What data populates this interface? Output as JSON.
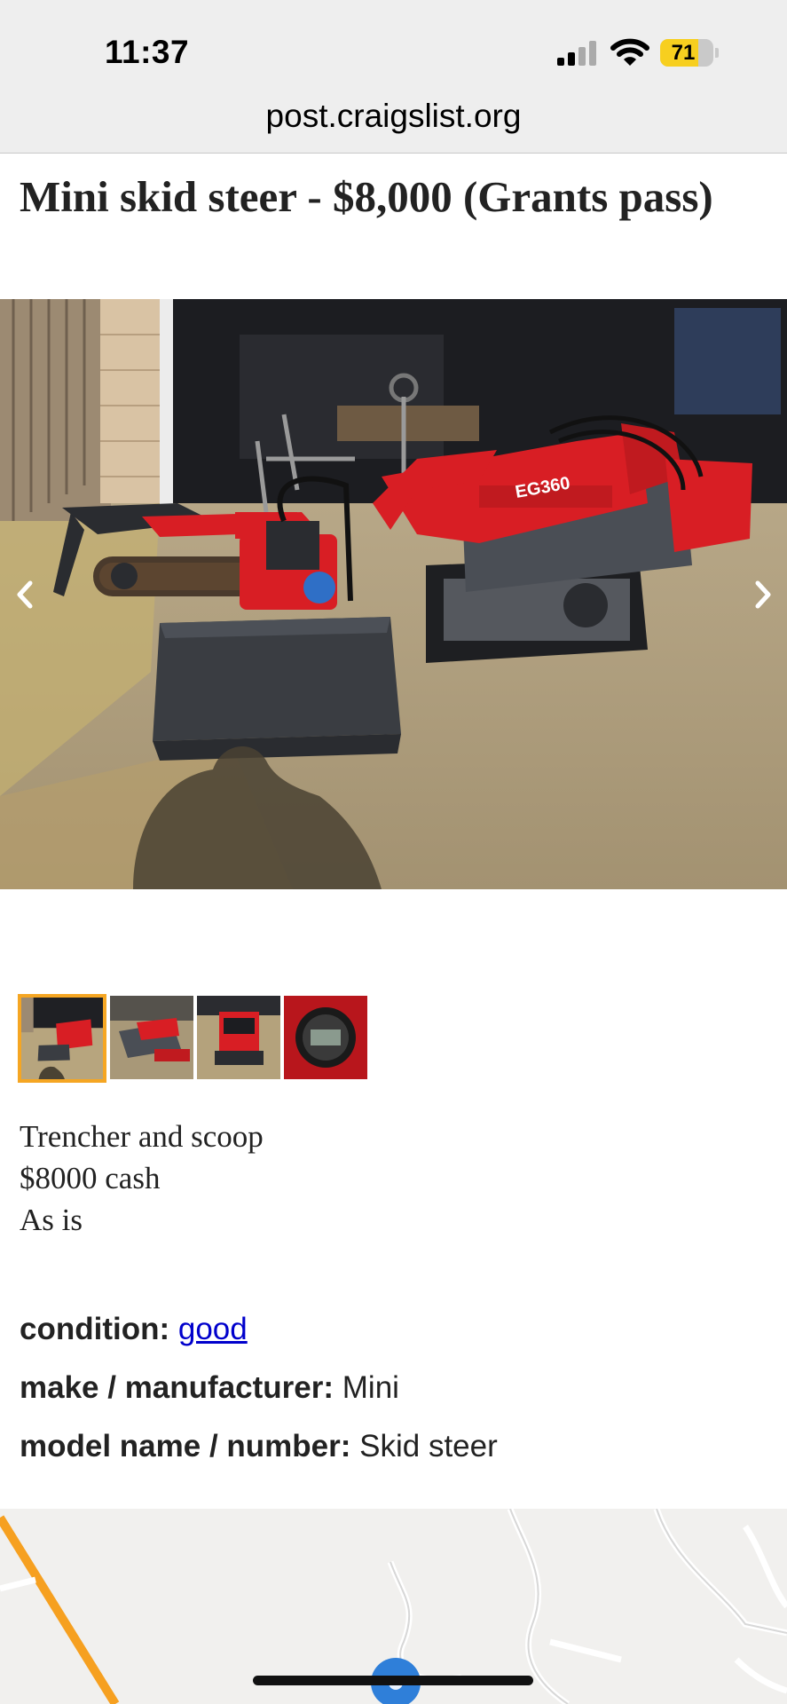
{
  "status_bar": {
    "time": "11:37",
    "battery_level": "71",
    "battery_fraction": 0.71,
    "signal_bars_active": 2,
    "signal_bars_total": 4,
    "icons": [
      "signal-icon",
      "wifi-icon",
      "battery-icon"
    ]
  },
  "browser": {
    "url": "post.craigslist.org"
  },
  "posting": {
    "title": "Mini skid steer - $8,000 (Grants pass)",
    "body_lines": [
      "Trencher and scoop",
      "$8000 cash",
      "As is"
    ]
  },
  "gallery": {
    "image_count": 4,
    "selected_index": 0,
    "prev_icon": "chevron-left-icon",
    "next_icon": "chevron-right-icon",
    "machine_label": "EG360"
  },
  "attributes": [
    {
      "label": "condition:",
      "value": "good",
      "is_link": true
    },
    {
      "label": "make / manufacturer:",
      "value": "Mini",
      "is_link": false
    },
    {
      "label": "model name / number:",
      "value": "Skid steer",
      "is_link": false
    }
  ],
  "colors": {
    "chrome_bg": "#eeeeee",
    "battery_yellow": "#f7cf1f",
    "thumb_selected_border": "#f5a623",
    "link": "#0000cc",
    "machine_red": "#d81e24"
  },
  "map": {
    "marker_icon": "map-pin-icon"
  }
}
